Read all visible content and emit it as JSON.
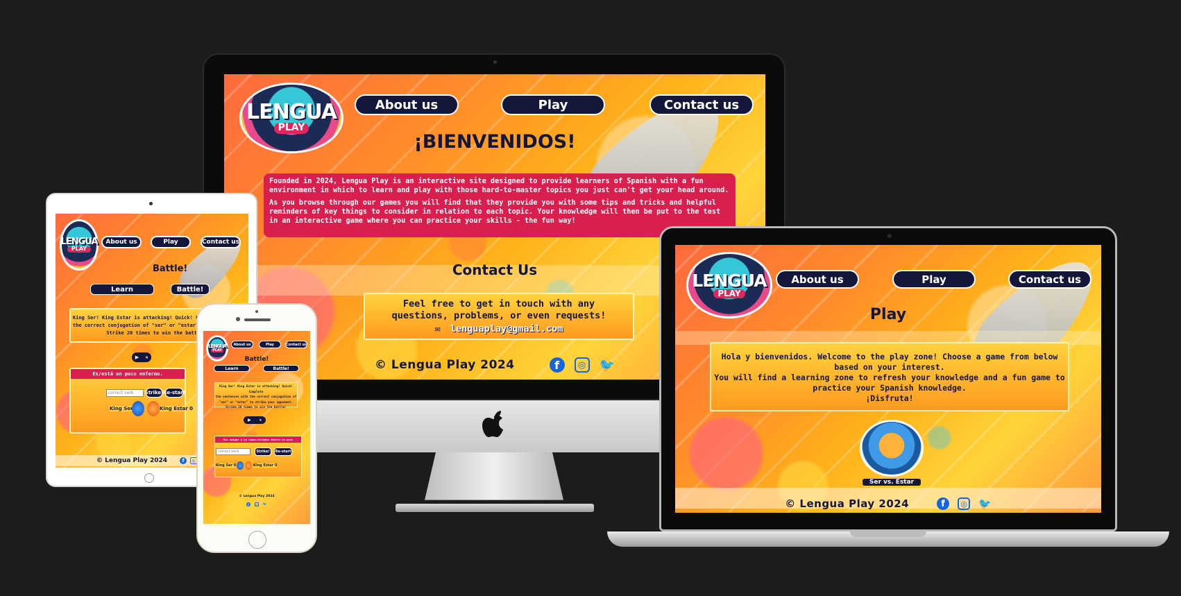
{
  "site": {
    "logo_line1": "LENGUA",
    "logo_line2": "PLAY",
    "nav": {
      "about": "About us",
      "play": "Play",
      "contact": "Contact us"
    },
    "footer_text": "© Lengua Play 2024",
    "social": {
      "facebook_icon": "f",
      "instagram_icon": "◎",
      "twitter_icon": "🐦"
    }
  },
  "imac": {
    "welcome_heading": "¡BIENVENIDOS!",
    "intro_p1": "Founded in 2024, Lengua Play is an interactive site designed to provide learners of Spanish with a fun environment in which to learn and play with those hard-to-master topics you just can't get your head around.",
    "intro_p2": "As you browse through our games you will find that they provide you with some tips and tricks and helpful reminders of key things to consider in relation to each topic. Your knowledge will then be put to the test in an interactive game where you can practice your skills - the fun way!",
    "contact_heading": "Contact Us",
    "contact_line1": "Feel free to get in touch with any",
    "contact_line2": "questions, problems, or even requests!",
    "email_icon": "✉",
    "email": "lenguaplay@gmail.com"
  },
  "laptop": {
    "heading": "Play",
    "box_line1": "Hola y bienvenidos. Welcome to the play zone! Choose a game from below",
    "box_line2": "based on your interest.",
    "box_line3": "You will find a learning zone to refresh your knowledge and a fun game to",
    "box_line4": "practice your Spanish knowledge.",
    "box_line5": "¡Disfruta!",
    "game_label": "Ser vs. Estar"
  },
  "tablet": {
    "heading": "Battle!",
    "learn_btn": "Learn",
    "battle_btn": "Battle!",
    "story_line1": "King Ser! King Estar is attacking! Quick! Complete the se",
    "story_line2": "the correct conjugation of \"ser\" or \"estar\" to strike you",
    "story_line3": "Strike 20 times to win the battle!",
    "prompt": "Es/está un poco enfermo.",
    "input_placeholder": "correct verb",
    "strike_btn": "Strike!",
    "restart_btn": "Re-start",
    "score_ser": "King Ser 0",
    "score_estar": "King Estar 0",
    "audio_play": "▶",
    "audio_pause": "⏸"
  },
  "phone": {
    "heading": "Battle!",
    "learn_btn": "Learn",
    "battle_btn": "Battle!",
    "story_line1": "King Ser! King Estar is attacking! Quick! Complete",
    "story_line2": "the sentences with the correct conjugation of",
    "story_line3": "\"ser\" or \"estar\" to strike your opponent.",
    "story_line4": "Strike 20 times to win the battle!",
    "prompt": "Mis amigos y yo somos/estamos dentro un poco",
    "input_placeholder": "correct verb",
    "strike_btn": "Strike!",
    "restart_btn": "Re-start",
    "score_ser": "King Ser 0",
    "score_estar": "King Estar 0",
    "footer_text": "© Lengua Play 2024",
    "audio_play": "▶",
    "audio_pause": "⏸"
  }
}
